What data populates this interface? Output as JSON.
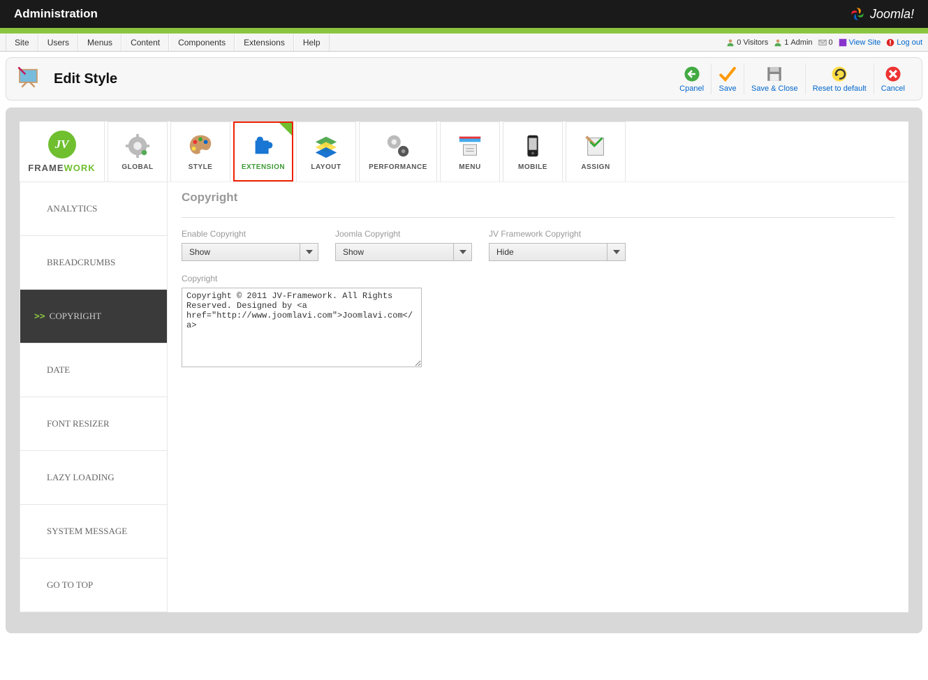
{
  "header": {
    "title": "Administration",
    "brand": "Joomla!"
  },
  "menu": {
    "items": [
      "Site",
      "Users",
      "Menus",
      "Content",
      "Components",
      "Extensions",
      "Help"
    ],
    "status": {
      "visitors_count": "0",
      "visitors_label": "Visitors",
      "admin_count": "1",
      "admin_label": "Admin",
      "messages_count": "0",
      "view_site": "View Site",
      "logout": "Log out"
    }
  },
  "page": {
    "title": "Edit Style"
  },
  "toolbar": {
    "cpanel": "Cpanel",
    "save": "Save",
    "save_close": "Save & Close",
    "reset": "Reset to default",
    "cancel": "Cancel"
  },
  "tabs": {
    "framework_a": "FRAME",
    "framework_b": "WORK",
    "global": "GLOBAL",
    "style": "STYLE",
    "extension": "EXTENSION",
    "layout": "LAYOUT",
    "performance": "PERFORMANCE",
    "menu": "MENU",
    "mobile": "MOBILE",
    "assign": "ASSIGN"
  },
  "sidebar": {
    "analytics": "ANALYTICS",
    "breadcrumbs": "BREADCRUMBS",
    "copyright": "COPYRIGHT",
    "date": "DATE",
    "font_resizer": "FONT RESIZER",
    "lazy_loading": "LAZY LOADING",
    "system_message": "SYSTEM MESSAGE",
    "go_to_top": "GO TO TOP"
  },
  "form": {
    "section_title": "Copyright",
    "enable_label": "Enable Copyright",
    "enable_value": "Show",
    "joomla_label": "Joomla Copyright",
    "joomla_value": "Show",
    "jv_label": "JV Framework Copyright",
    "jv_value": "Hide",
    "copyright_label": "Copyright",
    "copyright_text": "Copyright © 2011 JV-Framework. All Rights Reserved. Designed by <a href=\"http://www.joomlavi.com\">Joomlavi.com</a>"
  }
}
